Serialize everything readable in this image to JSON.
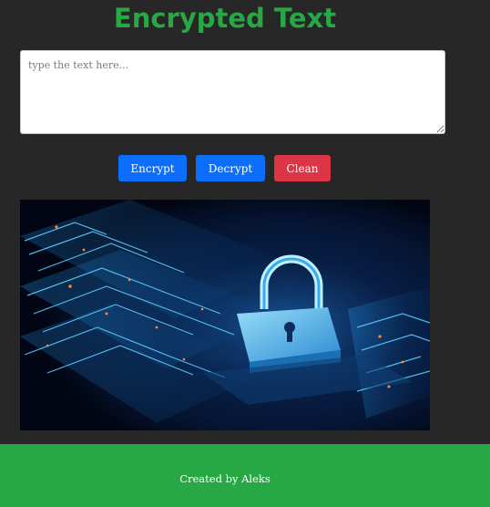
{
  "header": {
    "title": "Encrypted Text"
  },
  "input": {
    "placeholder": "type the text here...",
    "value": ""
  },
  "buttons": {
    "encrypt_label": "Encrypt",
    "decrypt_label": "Decrypt",
    "clean_label": "Clean"
  },
  "hero_image": {
    "icon": "padlock-icon"
  },
  "footer": {
    "credit": "Created by Aleks"
  },
  "colors": {
    "background": "#272727",
    "accent_green": "#28a745",
    "primary_blue": "#0d6efd",
    "danger_red": "#dc3545"
  }
}
